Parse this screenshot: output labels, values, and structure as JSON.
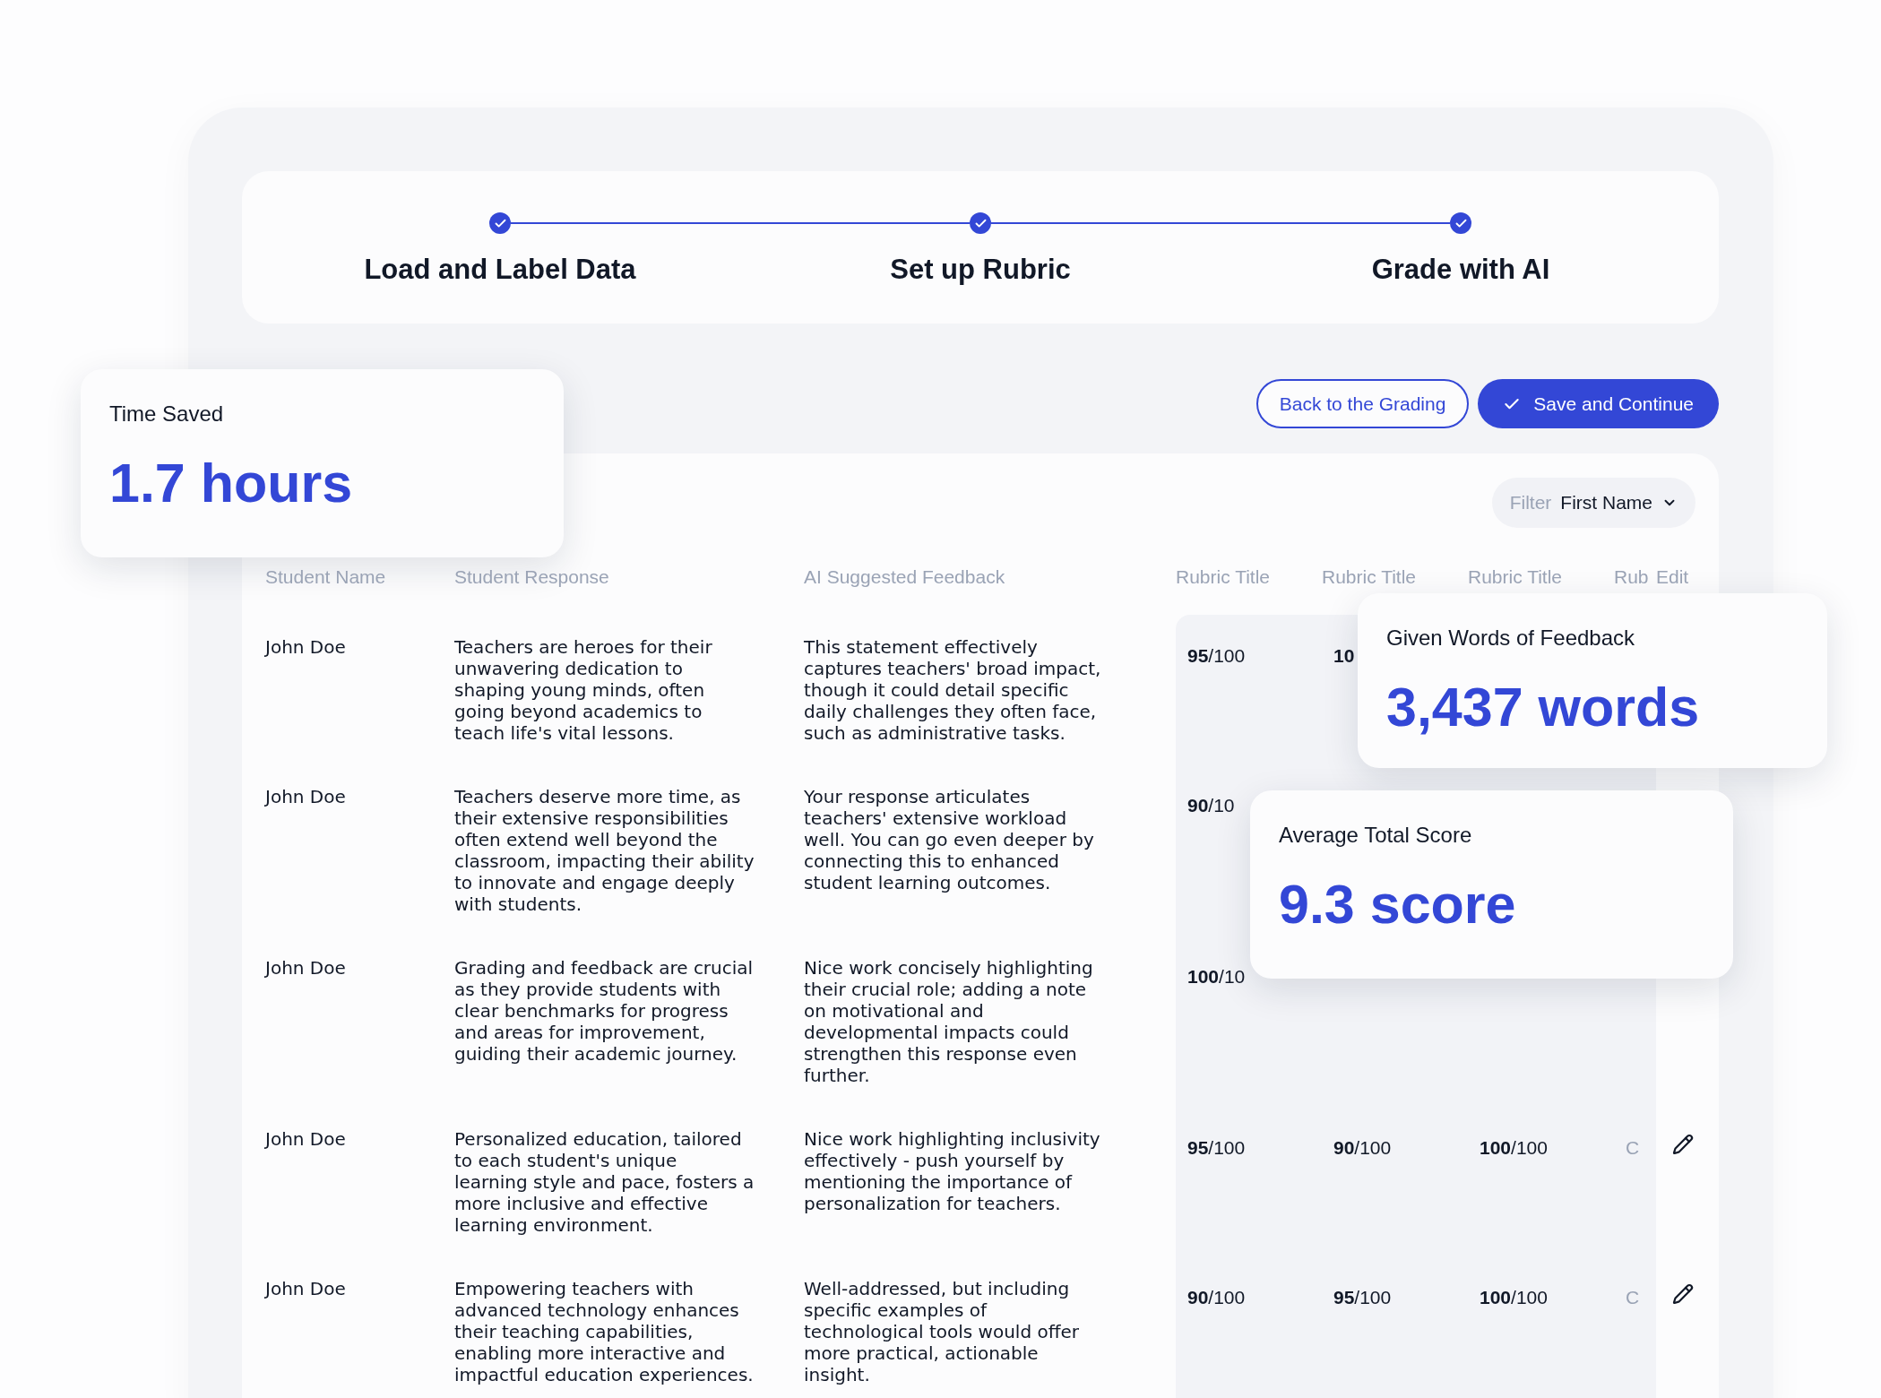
{
  "steps": [
    {
      "label": "Load and Label Data",
      "done": true
    },
    {
      "label": "Set up Rubric",
      "done": true
    },
    {
      "label": "Grade with AI",
      "done": true
    }
  ],
  "actions": {
    "back": "Back to the Grading",
    "save": "Save and Continue"
  },
  "filter": {
    "label": "Filter",
    "value": "First Name"
  },
  "table": {
    "columns": [
      "Student Name",
      "Student Response",
      "AI Suggested Feedback",
      "Rubric Title",
      "Rubric Title",
      "Rubric Title",
      "Rub",
      "Edit"
    ],
    "rows": [
      {
        "name": "John Doe",
        "response": "Teachers are heroes for their unwavering dedication to shaping young minds, often going beyond academics to teach life's vital lessons.",
        "feedback": "This statement effectively captures teachers' broad impact, though it could detail specific daily challenges they often face, such as administrative tasks.",
        "scores": [
          {
            "score": "95",
            "total": "/100"
          },
          {
            "score": "10"
          }
        ]
      },
      {
        "name": "John Doe",
        "response": "Teachers deserve more time, as their extensive responsibilities often extend well beyond the classroom, impacting their ability to innovate and engage deeply with students.",
        "feedback": "Your response articulates teachers' extensive workload well. You can go even deeper by connecting this to enhanced student learning outcomes.",
        "scores": [
          {
            "score": "90",
            "total": "/10"
          }
        ]
      },
      {
        "name": "John Doe",
        "response": "Grading and feedback are crucial as they provide students with clear benchmarks for progress and areas for improvement, guiding their academic journey.",
        "feedback": "Nice work concisely highlighting their crucial role; adding a note on motivational and developmental impacts could strengthen this response even further.",
        "scores": [
          {
            "score": "100",
            "total": "/10"
          }
        ]
      },
      {
        "name": "John Doe",
        "response": "Personalized education, tailored to each student's unique learning style and pace, fosters a more inclusive and effective learning environment.",
        "feedback": "Nice work highlighting inclusivity effectively - push yourself by mentioning the importance of personalization for teachers.",
        "scores": [
          {
            "score": "95",
            "total": "/100"
          },
          {
            "score": "90",
            "total": "/100"
          },
          {
            "score": "100",
            "total": "/100"
          }
        ],
        "column_4": "C",
        "edit": true
      },
      {
        "name": "John Doe",
        "response": "Empowering teachers with advanced technology enhances their teaching capabilities, enabling more interactive and impactful education experiences.",
        "feedback": "Well-addressed, but including specific examples of technological tools would offer more practical, actionable insight.",
        "scores": [
          {
            "score": "90",
            "total": "/100"
          },
          {
            "score": "95",
            "total": "/100"
          },
          {
            "score": "100",
            "total": "/100"
          }
        ],
        "column_4": "C",
        "edit": true
      }
    ]
  },
  "stats": [
    {
      "label": "Time Saved",
      "value": "1.7 hours"
    },
    {
      "label": "Given Words of Feedback",
      "value": "3,437 words"
    },
    {
      "label": "Average Total Score",
      "value": "9.3 score"
    }
  ]
}
